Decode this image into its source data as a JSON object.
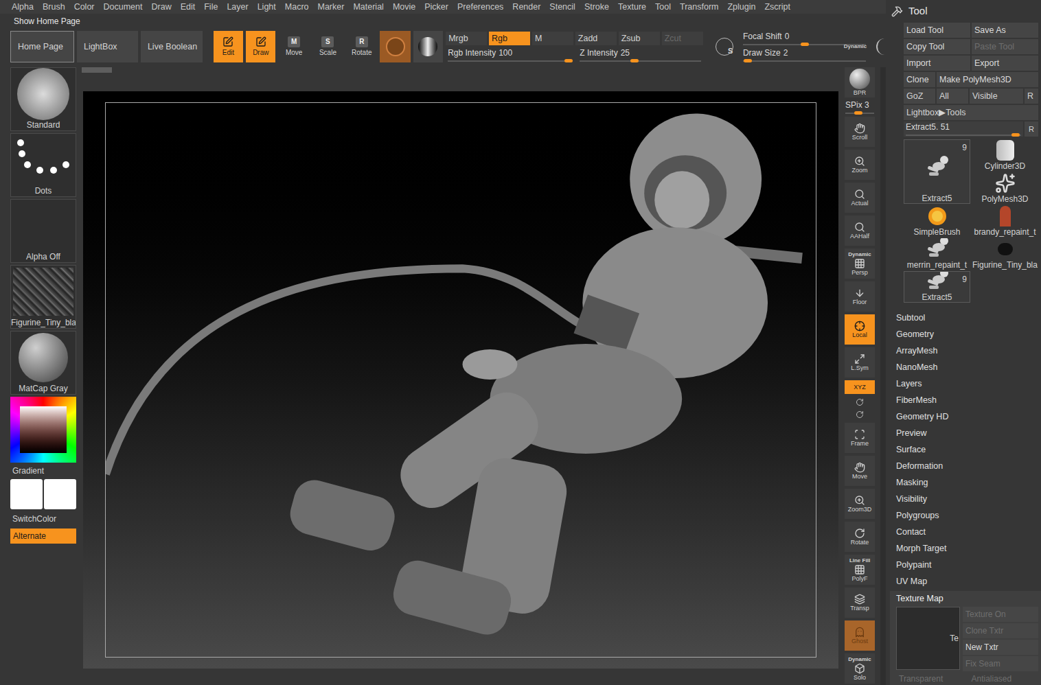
{
  "menu": [
    "Alpha",
    "Brush",
    "Color",
    "Document",
    "Draw",
    "Edit",
    "File",
    "Layer",
    "Light",
    "Macro",
    "Marker",
    "Material",
    "Movie",
    "Picker",
    "Preferences",
    "Render",
    "Stencil",
    "Stroke",
    "Texture",
    "Tool",
    "Transform",
    "Zplugin",
    "Zscript"
  ],
  "home_bar": {
    "label": "Show Home Page"
  },
  "toolbar": {
    "nav": [
      {
        "label": "Home Page",
        "selected": true
      },
      {
        "label": "LightBox",
        "selected": false
      },
      {
        "label": "Live Boolean",
        "selected": false
      }
    ],
    "modes": [
      {
        "label": "Edit",
        "selected": true
      },
      {
        "label": "Draw",
        "selected": true
      }
    ],
    "transforms": [
      {
        "label": "Move",
        "key": "M"
      },
      {
        "label": "Scale",
        "key": "S"
      },
      {
        "label": "Rotate",
        "key": "R"
      }
    ],
    "color_modes": [
      {
        "label": "Mrgb",
        "selected": false,
        "disabled": false
      },
      {
        "label": "Rgb",
        "selected": true,
        "disabled": false
      },
      {
        "label": "M",
        "selected": false,
        "disabled": false
      },
      {
        "label": "Zadd",
        "selected": false,
        "disabled": false
      },
      {
        "label": "Zsub",
        "selected": false,
        "disabled": false
      },
      {
        "label": "Zcut",
        "selected": false,
        "disabled": true
      }
    ],
    "sliders": [
      {
        "label": "Rgb Intensity",
        "value": "100",
        "level": 1
      },
      {
        "label": "Z Intensity",
        "value": "25",
        "level": 0.45
      }
    ],
    "stroke_key": "S",
    "draw_sliders": [
      {
        "label": "Focal Shift",
        "value": "0",
        "level": 0.5
      },
      {
        "label": "Draw Size",
        "value": "2",
        "level": 0.04
      }
    ],
    "dynamic": "Dynamic"
  },
  "shelf": [
    {
      "label": "Standard",
      "kind": "brush"
    },
    {
      "label": "Dots",
      "kind": "dots"
    },
    {
      "label": "Alpha Off",
      "kind": "empty"
    },
    {
      "label": "Figurine_Tiny_bla",
      "kind": "texture"
    },
    {
      "label": "MatCap Gray",
      "kind": "sphere"
    }
  ],
  "color": {
    "label": "Gradient",
    "switch": "SwitchColor",
    "alternate": {
      "label": "Alternate",
      "selected": true
    }
  },
  "nav_strip": [
    {
      "label": "BPR",
      "top": "",
      "selected": false
    },
    {
      "label": "Scroll",
      "top": "",
      "selected": false
    },
    {
      "label": "Zoom",
      "top": "",
      "selected": false
    },
    {
      "label": "Actual",
      "top": "",
      "selected": false
    },
    {
      "label": "AAHalf",
      "top": "",
      "selected": false
    },
    {
      "label": "Persp",
      "top": "Dynamic",
      "selected": false
    },
    {
      "label": "Floor",
      "top": "",
      "selected": false
    },
    {
      "label": "Local",
      "top": "",
      "selected": true
    },
    {
      "label": "L.Sym",
      "top": "",
      "selected": false
    },
    {
      "label": "XYZ",
      "top": "",
      "selected": true
    },
    {
      "label": "Frame",
      "top": "",
      "selected": false
    },
    {
      "label": "Move",
      "top": "",
      "selected": false
    },
    {
      "label": "Zoom3D",
      "top": "",
      "selected": false
    },
    {
      "label": "Rotate",
      "top": "",
      "selected": false
    },
    {
      "label": "PolyF",
      "top": "Line Fill",
      "selected": false
    },
    {
      "label": "Transp",
      "top": "",
      "selected": false
    },
    {
      "label": "Ghost",
      "top": "",
      "selected": true
    },
    {
      "label": "Solo",
      "top": "Dynamic",
      "selected": false
    }
  ],
  "spix": {
    "label": "SPix 3",
    "level": 0.45
  },
  "tool_panel": {
    "title": "Tool",
    "buttons": [
      [
        {
          "label": "Load Tool",
          "disabled": false
        },
        {
          "label": "Save As",
          "disabled": false
        }
      ],
      [
        {
          "label": "Copy Tool",
          "disabled": false
        },
        {
          "label": "Paste Tool",
          "disabled": true
        }
      ],
      [
        {
          "label": "Import",
          "disabled": false
        },
        {
          "label": "Export",
          "disabled": false
        }
      ],
      [
        {
          "label": "Clone",
          "disabled": false
        },
        {
          "label": "Make PolyMesh3D",
          "disabled": false
        }
      ]
    ],
    "goz_row": [
      "GoZ",
      "All",
      "Visible",
      "R"
    ],
    "lightbox": "Lightbox▶Tools",
    "current": {
      "label": "Extract5. 51",
      "level": 0.95,
      "reset": "R"
    },
    "tools": [
      {
        "label": "Extract5",
        "count": "9",
        "kind": "figure",
        "selected": true
      },
      {
        "label": "Cylinder3D",
        "count": "",
        "kind": "cylinder",
        "selected": false
      },
      {
        "label": "PolyMesh3D",
        "count": "",
        "kind": "star",
        "selected": false
      },
      {
        "label": "SimpleBrush",
        "count": "",
        "kind": "brush",
        "selected": false
      },
      {
        "label": "brandy_repaint_t",
        "count": "",
        "kind": "statue",
        "selected": false
      },
      {
        "label": "merrin_repaint_t",
        "count": "",
        "kind": "figure",
        "selected": false
      },
      {
        "label": "Figurine_Tiny_bla",
        "count": "",
        "kind": "ball",
        "selected": false
      },
      {
        "label": "Extract5",
        "count": "9",
        "kind": "figure",
        "selected": true
      }
    ],
    "sections": [
      "Subtool",
      "Geometry",
      "ArrayMesh",
      "NanoMesh",
      "Layers",
      "FiberMesh",
      "Geometry HD",
      "Preview",
      "Surface",
      "Deformation",
      "Masking",
      "Visibility",
      "Polygroups",
      "Contact",
      "Morph Target",
      "Polypaint",
      "UV Map"
    ],
    "texture_map": {
      "title": "Texture Map",
      "expanded": true,
      "thumb_text": "Te",
      "buttons": [
        {
          "label": "Texture On",
          "disabled": true
        },
        {
          "label": "Clone Txtr",
          "disabled": true
        },
        {
          "label": "New Txtr",
          "disabled": false
        },
        {
          "label": "Fix Seam",
          "disabled": true
        }
      ],
      "bottom": [
        {
          "label": "Transparent",
          "disabled": true
        },
        {
          "label": "Antialiased",
          "disabled": true
        }
      ]
    }
  }
}
